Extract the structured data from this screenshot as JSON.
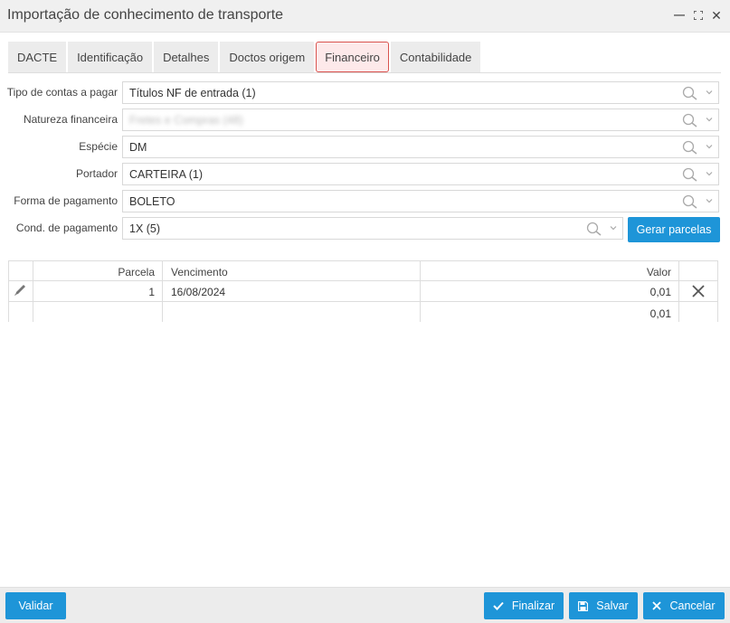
{
  "window": {
    "title": "Importação de conhecimento de transporte"
  },
  "tabs": [
    {
      "label": "DACTE"
    },
    {
      "label": "Identificação"
    },
    {
      "label": "Detalhes"
    },
    {
      "label": "Doctos origem"
    },
    {
      "label": "Financeiro"
    },
    {
      "label": "Contabilidade"
    }
  ],
  "active_tab": "Financeiro",
  "form": {
    "tipo_contas": {
      "label": "Tipo de contas a pagar",
      "value": "Títulos NF de entrada (1)"
    },
    "natureza": {
      "label": "Natureza financeira",
      "value": "Fretes e Compras (48)"
    },
    "especie": {
      "label": "Espécie",
      "value": "DM"
    },
    "portador": {
      "label": "Portador",
      "value": "CARTEIRA (1)"
    },
    "forma_pagamento": {
      "label": "Forma de pagamento",
      "value": "BOLETO"
    },
    "cond_pagamento": {
      "label": "Cond. de pagamento",
      "value": "1X (5)"
    },
    "gerar_parcelas_label": "Gerar parcelas"
  },
  "grid": {
    "headers": {
      "parcela": "Parcela",
      "vencimento": "Vencimento",
      "valor": "Valor"
    },
    "rows": [
      {
        "parcela": "1",
        "vencimento": "16/08/2024",
        "valor": "0,01"
      }
    ],
    "total": {
      "valor": "0,01"
    }
  },
  "footer": {
    "validar": "Validar",
    "finalizar": "Finalizar",
    "salvar": "Salvar",
    "cancelar": "Cancelar"
  },
  "colors": {
    "primary": "#1e95d8",
    "active_tab_border": "#d9534f",
    "active_tab_bg": "#fde9ea"
  },
  "icons": [
    "minimize-icon",
    "maximize-icon",
    "close-icon",
    "search-icon",
    "chevron-down-icon",
    "pencil-icon",
    "delete-icon",
    "check-icon",
    "save-icon",
    "cancel-icon"
  ]
}
